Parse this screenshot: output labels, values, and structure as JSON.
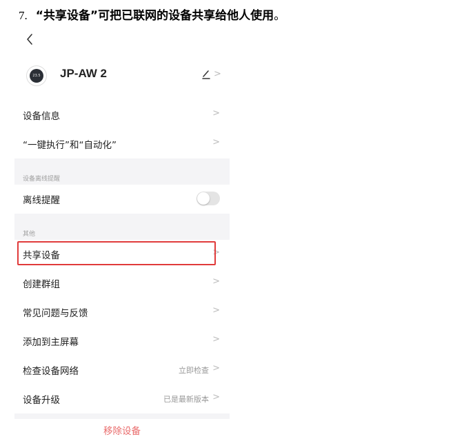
{
  "heading": {
    "number": "7.",
    "text": "“共享设备”可把已联网的设备共享给他人使用",
    "end": "。"
  },
  "screen": {
    "device": {
      "name": "JP-AW 2",
      "avatar_text": "23.5"
    },
    "rows_top": [
      {
        "label": "设备信息"
      },
      {
        "label": "“一键执行”和“自动化”"
      }
    ],
    "offline_section": {
      "header": "设备离线提醒",
      "row_label": "离线提醒",
      "toggle_on": false
    },
    "other_section": {
      "header": "其他",
      "rows": [
        {
          "label": "共享设备",
          "value": ""
        },
        {
          "label": "创建群组",
          "value": ""
        },
        {
          "label": "常见问题与反馈",
          "value": ""
        },
        {
          "label": "添加到主屏幕",
          "value": ""
        },
        {
          "label": "检查设备网络",
          "value": "立即检查"
        },
        {
          "label": "设备升级",
          "value": "已是最新版本"
        }
      ]
    },
    "remove_label": "移除设备"
  },
  "icons": {
    "back": "chevron-left-icon",
    "edit": "pencil-icon",
    "chevron": "chevron-right-icon"
  },
  "colors": {
    "highlight": "#e03a3a",
    "remove_text": "#e96a6a",
    "section_band": "#f4f4f6"
  }
}
